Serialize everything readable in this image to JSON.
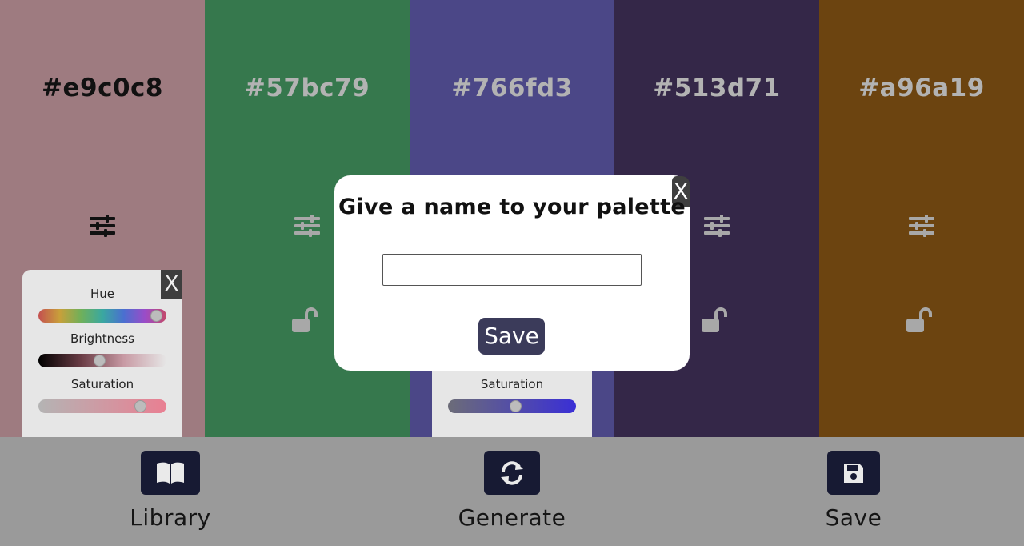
{
  "colors": [
    {
      "hex": "#e9c0c8",
      "background": "#9e7b80",
      "text_color": "#111111",
      "icon_color": "#111111"
    },
    {
      "hex": "#57bc79",
      "background": "#36784d",
      "text_color": "#b3b3b3",
      "icon_color": "#a8a8a8"
    },
    {
      "hex": "#766fd3",
      "background": "#4b4787",
      "text_color": "#b3b3b3",
      "icon_color": "#a8a8a8"
    },
    {
      "hex": "#513d71",
      "background": "#342748",
      "text_color": "#b3b3b3",
      "icon_color": "#a8a8a8"
    },
    {
      "hex": "#a96a19",
      "background": "#6c4410",
      "text_color": "#b3b3b3",
      "icon_color": "#a8a8a8"
    }
  ],
  "icons": {
    "adjust": "sliders-icon",
    "lock": "unlocked-padlock-icon",
    "library": "book-icon",
    "generate": "refresh-icon",
    "save": "floppy-disk-icon"
  },
  "adjust_panel_1": {
    "close_label": "X",
    "hue_label": "Hue",
    "brightness_label": "Brightness",
    "saturation_label": "Saturation",
    "hue_value": 0.94,
    "brightness_value": 0.48,
    "saturation_value": 0.8
  },
  "adjust_panel_3": {
    "saturation_label": "Saturation",
    "saturation_value": 0.53
  },
  "modal": {
    "title": "Give a name to your palette",
    "close_label": "X",
    "input_value": "",
    "save_label": "Save"
  },
  "bottom_bar": {
    "library_label": "Library",
    "generate_label": "Generate",
    "save_label": "Save"
  }
}
